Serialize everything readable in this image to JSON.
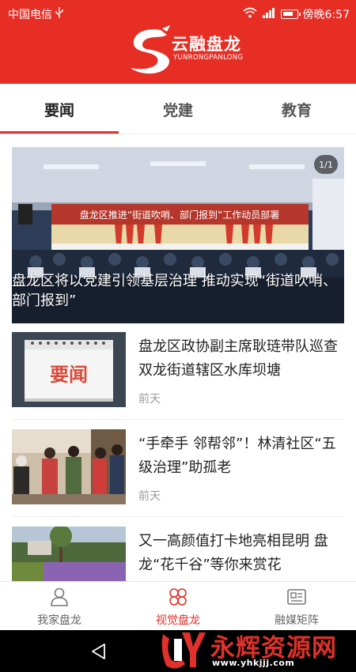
{
  "status": {
    "carrier": "中国电信",
    "time": "傍晚6:57"
  },
  "header": {
    "logo_title": "云融盘龙",
    "logo_subtitle": "YUNRONGPANLONG"
  },
  "tabs": [
    {
      "label": "要闻",
      "active": true
    },
    {
      "label": "党建",
      "active": false
    },
    {
      "label": "教育",
      "active": false
    }
  ],
  "hero": {
    "counter": "1/1",
    "banner_text": "盘龙区推进“街道吹哨、部门报到”工作动员部署",
    "caption": "盘龙区将以党建引领基层治理 推动实现“街道吹哨、部门报到”"
  },
  "news": [
    {
      "title": "盘龙区政协副主席耿琏带队巡查双龙街道辖区水库坝塘",
      "time": "前天",
      "thumb_text": "要闻"
    },
    {
      "title": "“手牵手 邻帮邻”！林清社区“五级治理”助孤老",
      "time": "前天"
    },
    {
      "title": "又一高颜值打卡地亮相昆明 盘龙“花千谷”等你来赏花",
      "time": ""
    }
  ],
  "bottom_nav": [
    {
      "label": "我家盘龙",
      "icon": "person-icon",
      "active": false
    },
    {
      "label": "视觉盘龙",
      "icon": "clover-icon",
      "active": true
    },
    {
      "label": "融媒矩阵",
      "icon": "newspaper-icon",
      "active": false
    }
  ],
  "watermark": {
    "text": "永辉资源网",
    "url": "www.yhkjjj.com"
  },
  "colors": {
    "brand_red": "#e62e25",
    "text_dark": "#222222",
    "text_muted": "#999999"
  }
}
